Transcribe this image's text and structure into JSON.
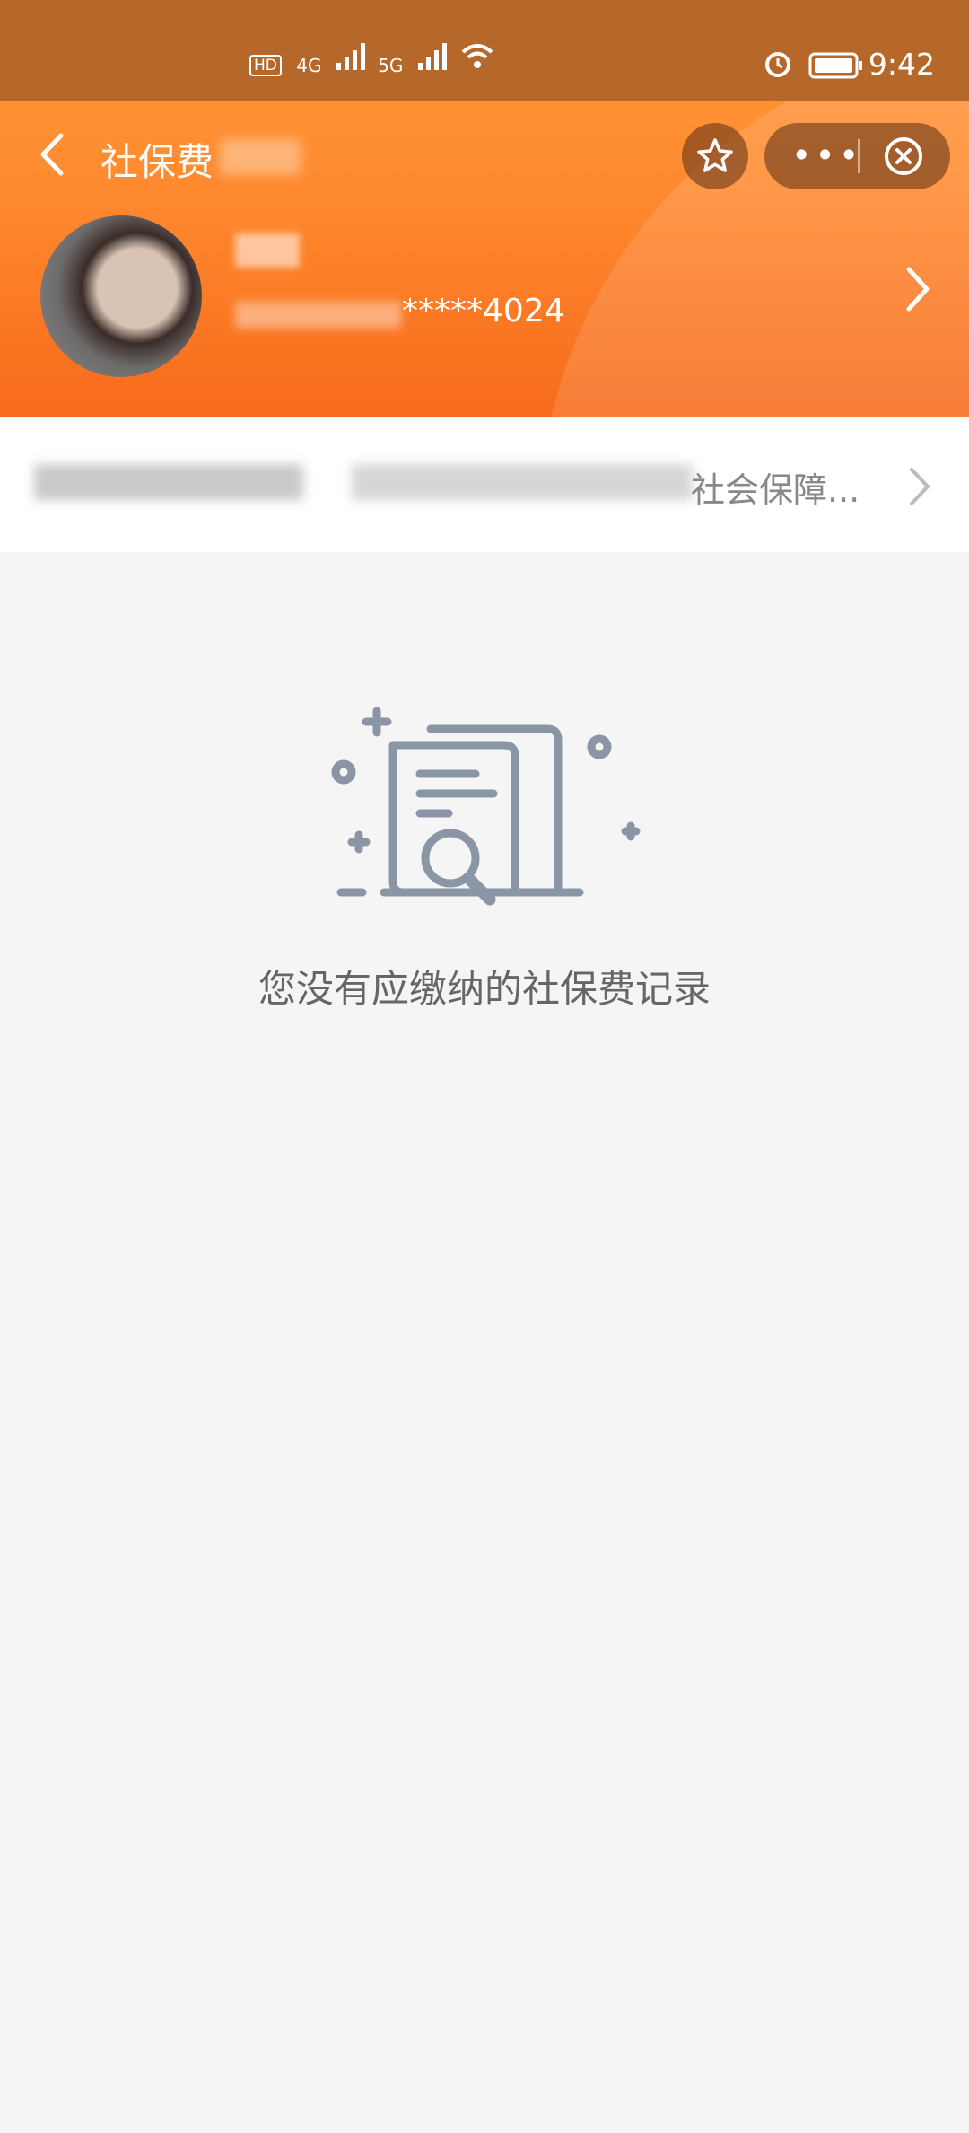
{
  "status_bar": {
    "time": "9:42",
    "network_1": "4G",
    "network_2": "5G"
  },
  "nav": {
    "title": "社保费"
  },
  "user": {
    "id_masked": "*****4024"
  },
  "info_row": {
    "text": "社会保障..."
  },
  "empty_state": {
    "message": "您没有应缴纳的社保费记录",
    "icon": "document-search-icon"
  },
  "colors": {
    "header_orange": "#ff8a2f",
    "status_bar_brown": "#b5682a",
    "background": "#f5f5f5",
    "icon_gray": "#8a95a5"
  }
}
